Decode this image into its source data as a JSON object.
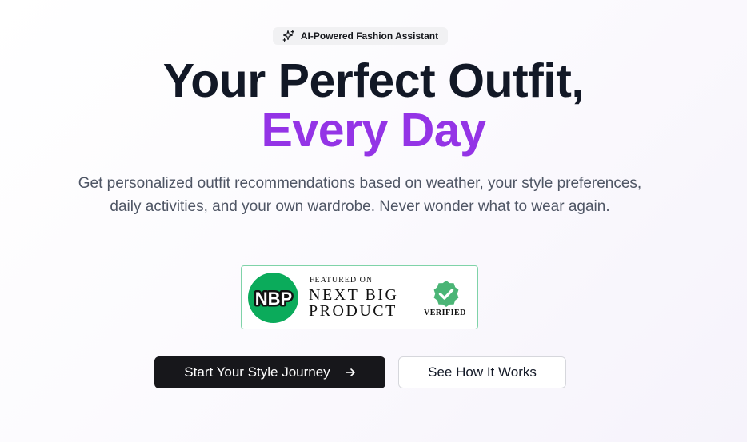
{
  "badge": {
    "icon": "sparkles-icon",
    "label": "AI-Powered Fashion Assistant"
  },
  "headline": {
    "line1": "Your Perfect Outfit,",
    "line2": "Every Day",
    "accent_color": "#9434e6"
  },
  "subheadline": "Get personalized outfit recommendations based on weather, your style preferences, daily activities, and your own wardrobe. Never wonder what to wear again.",
  "featured_badge": {
    "logo_text": "NBP",
    "featured_label": "FEATURED ON",
    "product_name": "NEXT BIG PRODUCT",
    "verified_label": "VERIFIED",
    "brand_color": "#0bab5b",
    "check_color": "#4bb576"
  },
  "cta": {
    "primary_label": "Start Your Style Journey",
    "primary_icon": "arrow-right-icon",
    "secondary_label": "See How It Works"
  }
}
